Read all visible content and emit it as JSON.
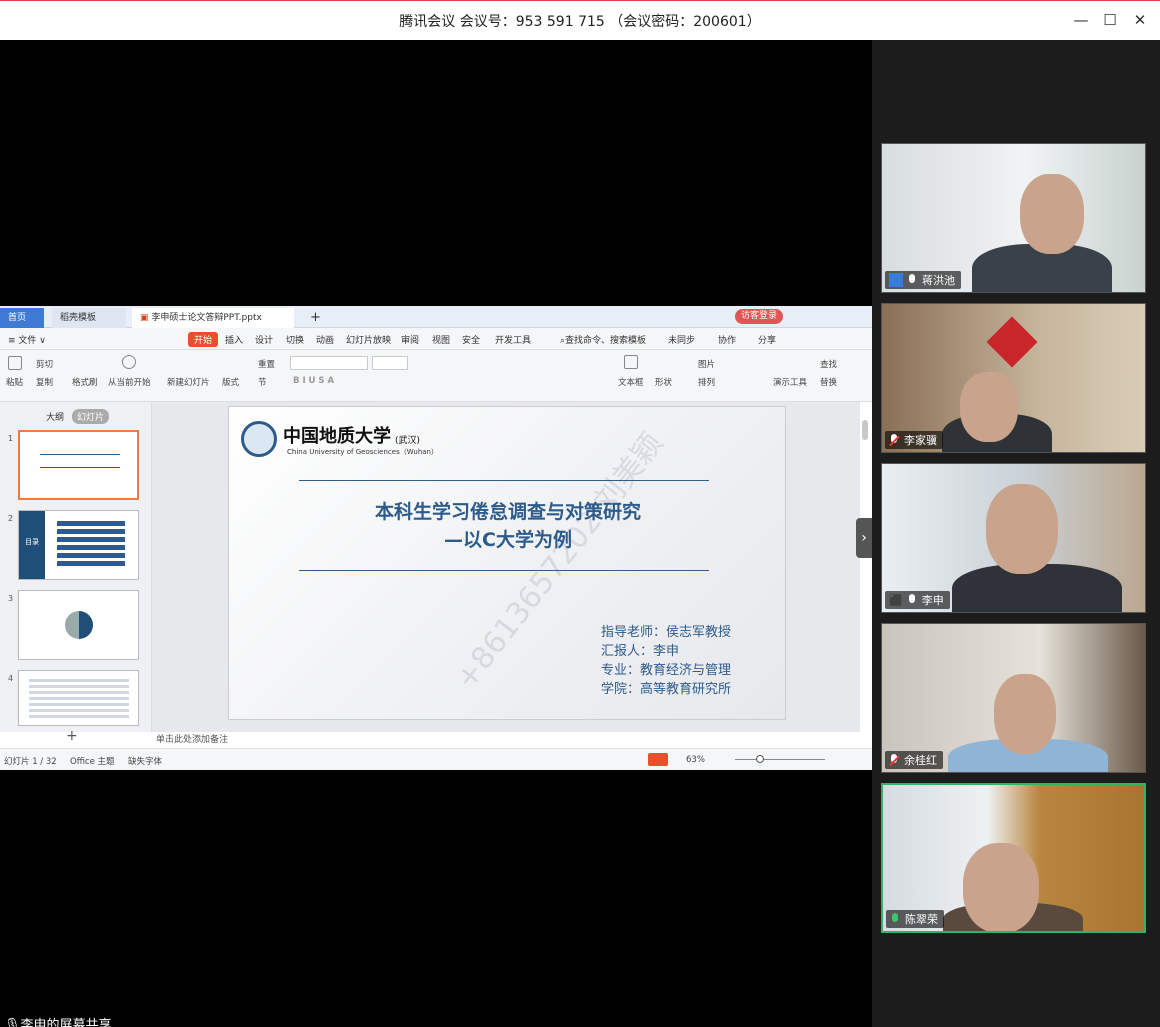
{
  "meeting": {
    "title": "腾讯会议 会议号：953 591 715 （会议密码：200601）",
    "share_label": "李申的屏幕共享"
  },
  "window_controls": {
    "minimize": "—",
    "maximize": "☐",
    "close": "✕"
  },
  "participants": [
    {
      "name": "蒋洪池",
      "mic": "on"
    },
    {
      "name": "李家骥",
      "mic": "muted"
    },
    {
      "name": "李申",
      "mic": "on"
    },
    {
      "name": "余桂红",
      "mic": "muted"
    },
    {
      "name": "陈翠荣",
      "mic": "speaking"
    }
  ],
  "wps": {
    "tabs": {
      "home": "首页",
      "template": "稻壳模板",
      "file": "李申硕士论文答辩PPT.pptx",
      "add": "+"
    },
    "login": "访客登录",
    "menu": [
      "≡ 文件 ∨",
      "开始",
      "插入",
      "设计",
      "切换",
      "动画",
      "幻灯片放映",
      "审阅",
      "视图",
      "安全",
      "开发工具",
      "查找命令、搜索模板",
      "未同步",
      "协作",
      "分享"
    ],
    "ribbon": {
      "paste": "粘贴",
      "cut": "剪切",
      "copy": "复制",
      "format": "格式刷",
      "play": "从当前开始",
      "new_slide": "新建幻灯片",
      "layout": "版式",
      "section": "节",
      "reset": "重置",
      "textbox": "文本框",
      "shape": "形状",
      "image": "图片",
      "arrange": "排列",
      "tools": "演示工具",
      "find": "查找",
      "replace": "替换"
    },
    "panel_tabs": {
      "outline": "大纲",
      "slides": "幻灯片"
    },
    "thumbs": [
      {
        "num": "1"
      },
      {
        "num": "2",
        "label": "目录"
      },
      {
        "num": "3"
      },
      {
        "num": "4"
      }
    ],
    "notes": "单击此处添加备注",
    "status": {
      "slide": "幻灯片 1 / 32",
      "theme": "Office 主题",
      "font": "缺失字体",
      "zoom": "63%"
    }
  },
  "slide": {
    "university_cn": "中国地质大学",
    "university_suffix": "(武汉)",
    "university_en": "China University of Geosciences（Wuhan）",
    "title_line1": "本科生学习倦怠调查与对策研究",
    "title_line2": "—以C大学为例",
    "info": [
      "指导老师：侯志军教授",
      "汇报人：李申",
      "专业：教育经济与管理",
      "学院：高等教育研究所"
    ],
    "watermark": "+8613657202 刘美颖"
  }
}
